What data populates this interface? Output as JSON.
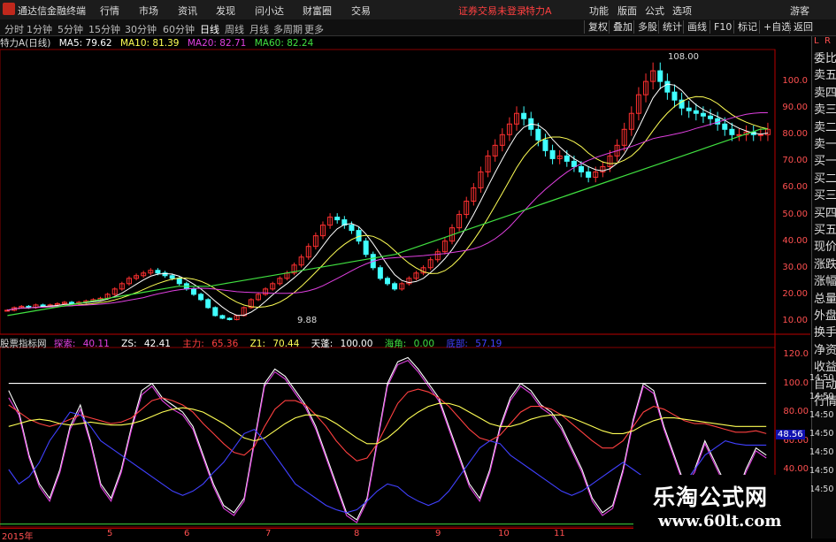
{
  "app": {
    "title": "通达信金融终端",
    "menu": [
      "行情",
      "市场",
      "资讯",
      "发现",
      "问小达",
      "财富圈",
      "交易"
    ],
    "warning": "证券交易未登录",
    "stock_name": "特力A",
    "right_menu": [
      "功能",
      "版面",
      "公式",
      "选项"
    ],
    "logout": "游客"
  },
  "toolbar": {
    "periods": [
      "分时",
      "1分钟",
      "5分钟",
      "15分钟",
      "30分钟",
      "60分钟",
      "日线",
      "周线",
      "月线",
      "多周期",
      "更多"
    ],
    "active_period": "日线",
    "right_buttons": [
      "复权",
      "叠加",
      "多股",
      "统计",
      "画线",
      "F10",
      "标记",
      "+自选",
      "返回"
    ]
  },
  "info_line": {
    "stock_label": "特力A",
    "period_label": "(日线)",
    "ma": [
      {
        "label": "MA5: 79.62",
        "color": "#ffffff"
      },
      {
        "label": "MA10: 81.39",
        "color": "#ffff55"
      },
      {
        "label": "MA20: 82.71",
        "color": "#e040e0"
      },
      {
        "label": "MA60: 82.24",
        "color": "#40e040"
      }
    ]
  },
  "price_axis": [
    "100.0",
    "90.00",
    "80.00",
    "70.00",
    "60.00",
    "50.00",
    "40.00",
    "30.00",
    "20.00",
    "10.00"
  ],
  "price_markers": {
    "high": "108.00",
    "low": "9.88"
  },
  "osc_legend": {
    "title": "股票指标网",
    "items": [
      {
        "label": "探索:",
        "value": "40.11",
        "color": "#e040e0"
      },
      {
        "label": "ZS:",
        "value": "42.41",
        "color": "#ffffff"
      },
      {
        "label": "主力:",
        "value": "65.36",
        "color": "#ff4040"
      },
      {
        "label": "Z1:",
        "value": "70.44",
        "color": "#ffff55"
      },
      {
        "label": "天蓬:",
        "value": "100.00",
        "color": "#ffffff"
      },
      {
        "label": "海角:",
        "value": "0.00",
        "color": "#40e040"
      },
      {
        "label": "底部:",
        "value": "57.19",
        "color": "#4040ff"
      }
    ]
  },
  "osc_axis": [
    "120.0",
    "100.0",
    "80.00",
    "60.00",
    "40.00",
    "20.00"
  ],
  "osc_last_value": "48.56",
  "right_panel": {
    "top": [
      "L",
      "R"
    ],
    "items": [
      "委比",
      "卖五",
      "卖四",
      "卖三",
      "卖二",
      "卖一",
      "买一",
      "买二",
      "买三",
      "买四",
      "买五",
      "现价",
      "涨跌",
      "涨幅",
      "总量",
      "外盘",
      "换手",
      "净资",
      "收益",
      "自动",
      "行情"
    ],
    "times": [
      "14:50",
      "14:50",
      "14:50",
      "14:50",
      "14:50",
      "14:50",
      "14:50"
    ]
  },
  "bottom_axis": [
    "2015年",
    "5",
    "6",
    "7",
    "8",
    "9",
    "10",
    "11"
  ],
  "watermark": {
    "cn": "乐淘公式网",
    "url": "www.60lt.com"
  },
  "chart_data": {
    "type": "candlestick",
    "price_range": [
      5,
      112
    ],
    "close_series": [
      14,
      15,
      15.5,
      15,
      16,
      15.5,
      16,
      16.5,
      17,
      16.5,
      17,
      17.5,
      18,
      18.5,
      20,
      22,
      24,
      26,
      27,
      28,
      29,
      28,
      27,
      26,
      24,
      22,
      20,
      18,
      15,
      12,
      11,
      10.5,
      12,
      15,
      18,
      20,
      22,
      24,
      26,
      28,
      31,
      34,
      38,
      42,
      46,
      49,
      48,
      46,
      44,
      40,
      35,
      30,
      26,
      24,
      22,
      24,
      26,
      28,
      30,
      33,
      36,
      40,
      45,
      50,
      55,
      60,
      66,
      72,
      76,
      80,
      84,
      88,
      86,
      82,
      78,
      74,
      71,
      72,
      70,
      68,
      66,
      64,
      66,
      68,
      72,
      76,
      82,
      88,
      95,
      100,
      104,
      100,
      96,
      93,
      90,
      89,
      88,
      87,
      86,
      84,
      82,
      80,
      80,
      81,
      80,
      80,
      82
    ],
    "ma60_series": [
      12,
      12.5,
      13,
      13.5,
      14,
      14.5,
      15,
      15.5,
      16,
      16.5,
      17,
      17.5,
      18,
      18.5,
      19,
      19.5,
      20,
      20.5,
      21,
      21.5,
      22,
      22.5,
      23,
      23,
      23,
      23,
      23,
      23.5,
      24,
      24.5,
      25,
      25.5,
      26,
      26.5,
      27,
      27.5,
      28,
      28.5,
      29,
      29.5,
      30,
      30.5,
      31,
      31.5,
      32,
      32.5,
      33,
      33.5,
      34,
      34.5,
      35,
      36,
      37,
      38,
      39,
      40,
      41,
      42,
      43,
      44,
      45,
      46,
      47,
      48,
      49,
      50,
      51,
      52,
      53,
      54,
      55,
      56,
      57,
      58,
      59,
      60,
      61,
      62,
      63,
      64,
      65,
      66,
      67,
      68,
      69,
      70,
      71,
      72,
      73,
      74,
      75,
      76,
      77,
      78,
      79,
      80,
      81,
      82,
      82.2
    ],
    "osc_range": [
      0,
      125
    ],
    "osc_series": [
      {
        "name": "ZS",
        "color": "#ffffff",
        "values": [
          95,
          80,
          50,
          30,
          20,
          40,
          70,
          85,
          60,
          30,
          20,
          40,
          70,
          95,
          100,
          90,
          85,
          80,
          70,
          50,
          30,
          15,
          10,
          20,
          60,
          100,
          110,
          105,
          95,
          85,
          70,
          50,
          30,
          10,
          5,
          20,
          60,
          100,
          115,
          118,
          110,
          100,
          90,
          70,
          50,
          30,
          20,
          40,
          70,
          90,
          100,
          95,
          85,
          80,
          70,
          55,
          40,
          20,
          10,
          15,
          40,
          75,
          100,
          95,
          70,
          50,
          30,
          40,
          60,
          45,
          30,
          20,
          40,
          55,
          50
        ]
      },
      {
        "name": "探索",
        "color": "#e040e0",
        "values": [
          90,
          78,
          48,
          28,
          18,
          38,
          68,
          82,
          58,
          28,
          18,
          38,
          68,
          92,
          98,
          88,
          82,
          78,
          68,
          48,
          28,
          13,
          8,
          18,
          58,
          98,
          108,
          103,
          93,
          83,
          68,
          48,
          28,
          8,
          3,
          18,
          58,
          98,
          113,
          116,
          108,
          98,
          88,
          68,
          48,
          28,
          18,
          38,
          68,
          88,
          98,
          93,
          83,
          78,
          68,
          53,
          38,
          18,
          8,
          13,
          38,
          73,
          98,
          93,
          68,
          48,
          28,
          38,
          58,
          43,
          28,
          18,
          38,
          53,
          48
        ]
      },
      {
        "name": "主力",
        "color": "#ff4040",
        "values": [
          85,
          80,
          75,
          72,
          70,
          72,
          75,
          78,
          76,
          74,
          72,
          73,
          76,
          82,
          88,
          90,
          88,
          85,
          80,
          72,
          65,
          58,
          52,
          50,
          56,
          70,
          82,
          88,
          88,
          85,
          78,
          70,
          60,
          52,
          46,
          48,
          58,
          72,
          86,
          94,
          96,
          94,
          90,
          84,
          76,
          68,
          62,
          60,
          64,
          72,
          80,
          84,
          84,
          82,
          78,
          72,
          66,
          60,
          55,
          55,
          60,
          70,
          80,
          84,
          82,
          78,
          74,
          72,
          72,
          70,
          68,
          66,
          66,
          67,
          65
        ]
      },
      {
        "name": "Z1",
        "color": "#ffff55",
        "values": [
          70,
          72,
          74,
          75,
          74,
          72,
          71,
          72,
          73,
          72,
          71,
          71,
          72,
          74,
          77,
          80,
          82,
          83,
          82,
          80,
          76,
          72,
          67,
          62,
          60,
          62,
          67,
          72,
          76,
          78,
          78,
          76,
          72,
          67,
          62,
          58,
          58,
          62,
          68,
          75,
          80,
          84,
          86,
          86,
          84,
          80,
          76,
          72,
          70,
          70,
          72,
          75,
          77,
          78,
          78,
          76,
          73,
          70,
          67,
          65,
          65,
          67,
          71,
          74,
          76,
          76,
          75,
          74,
          73,
          72,
          71,
          70,
          70,
          70,
          70
        ]
      },
      {
        "name": "底部",
        "color": "#4040ff",
        "values": [
          40,
          30,
          35,
          45,
          60,
          70,
          80,
          78,
          70,
          60,
          55,
          50,
          45,
          40,
          35,
          30,
          25,
          22,
          25,
          30,
          38,
          45,
          55,
          65,
          68,
          60,
          50,
          40,
          30,
          25,
          20,
          15,
          12,
          10,
          12,
          18,
          25,
          30,
          28,
          22,
          18,
          15,
          18,
          25,
          35,
          45,
          55,
          60,
          58,
          50,
          45,
          40,
          35,
          30,
          25,
          22,
          25,
          30,
          35,
          40,
          45,
          40,
          35,
          30,
          28,
          25,
          30,
          40,
          50,
          55,
          60,
          58,
          57,
          57,
          57
        ]
      },
      {
        "name": "天蓬",
        "color": "#ffffff",
        "values": [
          100,
          100,
          100,
          100,
          100,
          100,
          100,
          100,
          100,
          100,
          100,
          100,
          100,
          100,
          100,
          100,
          100,
          100,
          100,
          100,
          100,
          100,
          100,
          100,
          100,
          100,
          100,
          100,
          100,
          100,
          100,
          100,
          100,
          100,
          100,
          100,
          100,
          100,
          100,
          100,
          100,
          100,
          100,
          100,
          100,
          100,
          100,
          100,
          100,
          100,
          100,
          100,
          100,
          100,
          100,
          100,
          100,
          100,
          100,
          100,
          100,
          100,
          100,
          100,
          100,
          100,
          100,
          100,
          100,
          100,
          100,
          100,
          100,
          100,
          100
        ]
      }
    ]
  }
}
